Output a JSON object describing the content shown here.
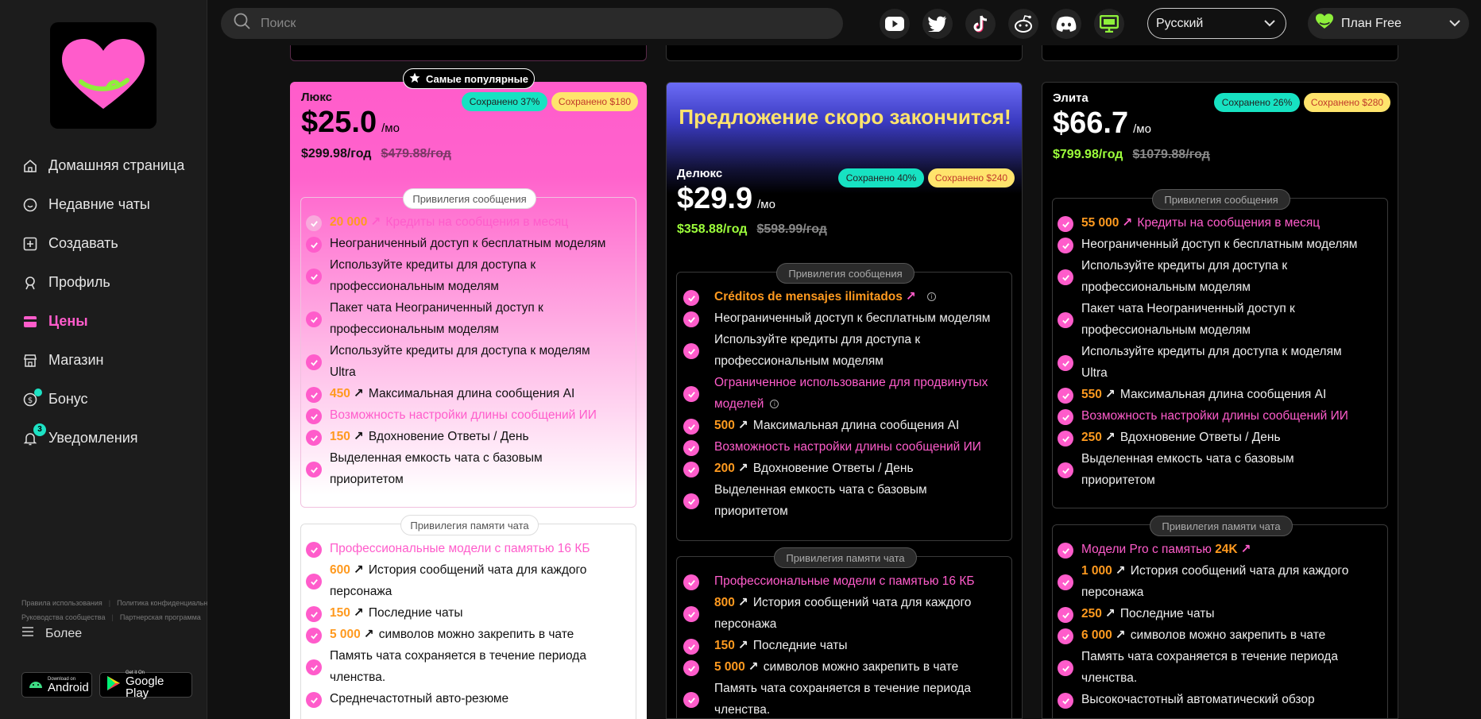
{
  "search": {
    "placeholder": "Поиск"
  },
  "sidebar": {
    "items": [
      {
        "label": "Домашняя страница",
        "icon": "home-icon"
      },
      {
        "label": "Недавние чаты",
        "icon": "chat-icon"
      },
      {
        "label": "Создавать",
        "icon": "plus-square-icon"
      },
      {
        "label": "Профиль",
        "icon": "profile-icon"
      },
      {
        "label": "Цены",
        "icon": "pricing-icon",
        "active": true
      },
      {
        "label": "Магазин",
        "icon": "store-icon"
      },
      {
        "label": "Бонус",
        "icon": "coin-icon",
        "dot": true
      },
      {
        "label": "Уведомления",
        "icon": "bell-icon",
        "badge": "3"
      }
    ],
    "footer_links": [
      "Правила использования",
      "Политика конфиденциальности",
      "Руководства сообщества",
      "Партнерская программа"
    ],
    "more_label": "Более",
    "android": {
      "small": "Download on",
      "big": "Android"
    },
    "google_play": {
      "small": "Get it On",
      "big": "Google Play"
    }
  },
  "topbar": {
    "language": "Русский",
    "plan": "План Free",
    "social": [
      "youtube-icon",
      "twitter-icon",
      "tiktok-icon",
      "reddit-icon",
      "discord-icon",
      "desktop-icon"
    ]
  },
  "colors": {
    "accent_pink": "#ff5ccb",
    "accent_orange": "#ff9a1f",
    "teal": "#17e2c2",
    "yellow": "#ffe46c",
    "green": "#9dff3b"
  },
  "cards": {
    "lux": {
      "popular_tag": "Самые популярные",
      "name": "Люкс",
      "price": "$25.0",
      "per": "/мо",
      "yearly": "$299.98/год",
      "yearly_old": "$479.88/год",
      "saved_pct": "Сохранено 37%",
      "saved_amt": "Сохранено $180",
      "msg_label": "Привилегия сообщения",
      "msg": {
        "f1_num": "20 000",
        "f1_text": "Кредиты на сообщения в месяц",
        "f2": "Неограниченный доступ к бесплатным моделям",
        "f3a": "Используйте кредиты для доступа к",
        "f3b": "профессиональным моделям",
        "f4a": "Пакет чата Неограниченный доступ к",
        "f4b": "профессиональным моделям",
        "f5a": "Используйте кредиты для доступа к моделям",
        "f5b": "Ultra",
        "f6_num": "450",
        "f6_text": "Максимальная длина сообщения AI",
        "f7": "Возможность настройки длины сообщений ИИ",
        "f8_num": "150",
        "f8_text": "Вдохновение Ответы / День",
        "f9a": "Выделенная емкость чата с базовым",
        "f9b": "приоритетом"
      },
      "mem_label": "Привилегия памяти чата",
      "mem": {
        "m1": "Профессиональные модели с памятью 16 КБ",
        "m2_num": "600",
        "m2a": "История сообщений чата для каждого",
        "m2b": "персонажа",
        "m3_num": "150",
        "m3_text": "Последние чаты",
        "m4_num": "5 000",
        "m4_text": "символов можно закрепить в чате",
        "m5a": "Память чата сохраняется в течение периода",
        "m5b": "членства.",
        "m6": "Среднечастотный авто-резюме"
      }
    },
    "deluxe": {
      "banner": "Предложение скоро закончится!",
      "name": "Делюкс",
      "price": "$29.9",
      "per": "/мо",
      "yearly": "$358.88/год",
      "yearly_old": "$598.99/год",
      "saved_pct": "Сохранено 40%",
      "saved_amt": "Сохранено $240",
      "msg_label": "Привилегия сообщения",
      "msg": {
        "f1": "Créditos de mensajes ilimitados",
        "f2": "Неограниченный доступ к бесплатным моделям",
        "f3a": "Используйте кредиты для доступа к",
        "f3b": "профессиональным моделям",
        "f4a": "Ограниченное использование для продвинутых",
        "f4b": "моделей",
        "f5_num": "500",
        "f5_text": "Максимальная длина сообщения AI",
        "f6": "Возможность настройки длины сообщений ИИ",
        "f7_num": "200",
        "f7_text": "Вдохновение Ответы / День",
        "f8a": "Выделенная емкость чата с базовым",
        "f8b": "приоритетом"
      },
      "mem_label": "Привилегия памяти чата",
      "mem": {
        "m1": "Профессиональные модели с памятью 16 КБ",
        "m2_num": "800",
        "m2a": "История сообщений чата для каждого",
        "m2b": "персонажа",
        "m3_num": "150",
        "m3_text": "Последние чаты",
        "m4_num": "5 000",
        "m4_text": "символов можно закрепить в чате",
        "m5a": "Память чата сохраняется в течение периода",
        "m5b": "членства."
      }
    },
    "elite": {
      "name": "Элита",
      "price": "$66.7",
      "per": "/мо",
      "yearly": "$799.98/год",
      "yearly_old": "$1079.88/год",
      "saved_pct": "Сохранено 26%",
      "saved_amt": "Сохранено $280",
      "msg_label": "Привилегия сообщения",
      "msg": {
        "f1_num": "55 000",
        "f1_text": "Кредиты на сообщения в месяц",
        "f2": "Неограниченный доступ к бесплатным моделям",
        "f3a": "Используйте кредиты для доступа к",
        "f3b": "профессиональным моделям",
        "f4a": "Пакет чата Неограниченный доступ к",
        "f4b": "профессиональным моделям",
        "f5a": "Используйте кредиты для доступа к моделям",
        "f5b": "Ultra",
        "f6_num": "550",
        "f6_text": "Максимальная длина сообщения AI",
        "f7": "Возможность настройки длины сообщений ИИ",
        "f8_num": "250",
        "f8_text": "Вдохновение Ответы / День",
        "f9a": "Выделенная емкость чата с базовым",
        "f9b": "приоритетом"
      },
      "mem_label": "Привилегия памяти чата",
      "mem": {
        "m1a": "Модели Pro с памятью",
        "m1_num": "24K",
        "m2_num": "1 000",
        "m2a": "История сообщений чата для каждого",
        "m2b": "персонажа",
        "m3_num": "250",
        "m3_text": "Последние чаты",
        "m4_num": "6 000",
        "m4_text": "символов можно закрепить в чате",
        "m5a": "Память чата сохраняется в течение периода",
        "m5b": "членства.",
        "m6": "Высокочастотный автоматический обзор"
      }
    }
  }
}
